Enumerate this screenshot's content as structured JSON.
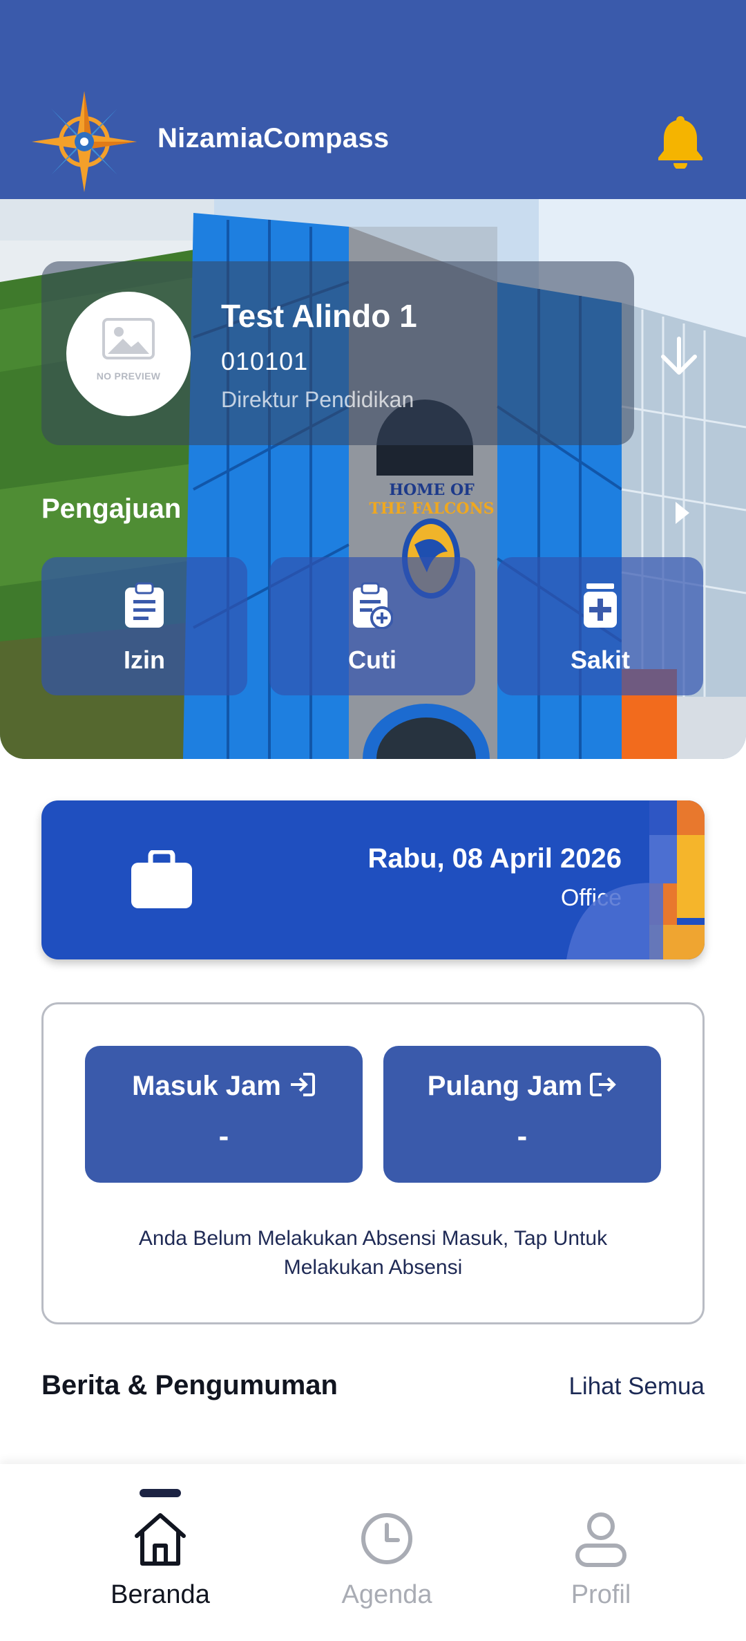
{
  "app": {
    "title": "NizamiaCompass"
  },
  "profile": {
    "name": "Test Alindo 1",
    "employee_id": "010101",
    "role": "Direktur Pendidikan",
    "avatar_placeholder": "NO PREVIEW"
  },
  "hero": {
    "building_sign_line1": "HOME OF",
    "building_sign_line2": "THE FALCONS"
  },
  "requests": {
    "title": "Pengajuan",
    "items": [
      {
        "label": "Izin",
        "icon": "clipboard-list-icon"
      },
      {
        "label": "Cuti",
        "icon": "clipboard-add-icon"
      },
      {
        "label": "Sakit",
        "icon": "medicine-icon"
      }
    ]
  },
  "schedule": {
    "date": "Rabu, 08 April 2026",
    "location": "Office",
    "icon": "briefcase-icon"
  },
  "attendance": {
    "check_in_label": "Masuk Jam",
    "check_in_value": "-",
    "check_out_label": "Pulang Jam",
    "check_out_value": "-",
    "message": "Anda Belum Melakukan Absensi Masuk, Tap Untuk Melakukan Absensi"
  },
  "news": {
    "title": "Berita & Pengumuman",
    "see_all": "Lihat Semua"
  },
  "nav": {
    "items": [
      {
        "label": "Beranda",
        "icon": "home-icon",
        "active": true
      },
      {
        "label": "Agenda",
        "icon": "clock-icon",
        "active": false
      },
      {
        "label": "Profil",
        "icon": "user-icon",
        "active": false
      }
    ]
  },
  "colors": {
    "primary": "#3a5aab",
    "date_card": "#1f4fbf",
    "bell": "#f5b400",
    "accent_orange": "#e8782d"
  }
}
